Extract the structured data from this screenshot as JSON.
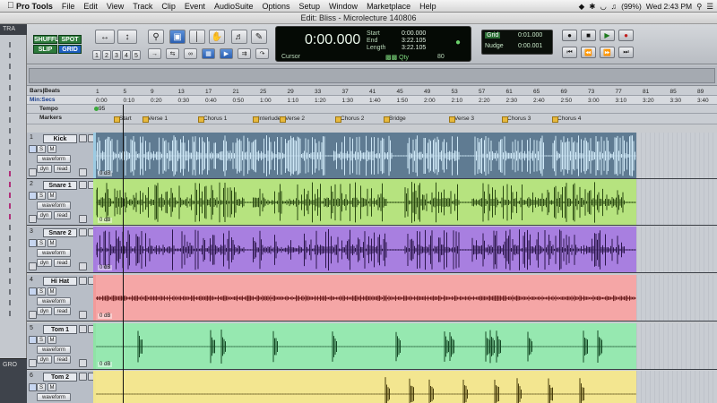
{
  "menubar": {
    "apple": "",
    "items": [
      "Pro Tools",
      "File",
      "Edit",
      "View",
      "Track",
      "Clip",
      "Event",
      "AudioSuite",
      "Options",
      "Setup",
      "Window",
      "Marketplace",
      "Help"
    ],
    "battery": "(99%)",
    "clock": "Wed 2:43 PM"
  },
  "window": {
    "title": "Edit: Bliss - Microlecture 140806"
  },
  "toolbar": {
    "modes": [
      "SHUFFLE",
      "SPOT",
      "SLIP",
      "GRID"
    ],
    "zoom_presets": [
      "1",
      "2",
      "3",
      "4",
      "5"
    ],
    "counter_main": "0:00.000",
    "start_label": "Start",
    "end_label": "End",
    "length_label": "Length",
    "start_value": "0:00.000",
    "end_value": "3:22.105",
    "length_value": "3:22.105",
    "cursor_label": "Cursor",
    "nudge_preset": "80",
    "grid_label": "Grid",
    "grid_value": "0:01.000",
    "nudge_label": "Nudge",
    "nudge_value": "0:00.001"
  },
  "left_panel": {
    "header": "TRA",
    "bottom": "GRO"
  },
  "rulers": {
    "bars_label": "Bars|Beats",
    "mins_label": "Min:Secs",
    "tempo_label": "Tempo",
    "tempo_value": "95",
    "markers_label": "Markers",
    "bars": [
      "1",
      "5",
      "9",
      "13",
      "17",
      "21",
      "25",
      "29",
      "33",
      "37",
      "41",
      "45",
      "49",
      "53",
      "57",
      "61",
      "65",
      "69",
      "73",
      "77",
      "81",
      "85",
      "89"
    ],
    "mins": [
      "0:00",
      "0:10",
      "0:20",
      "0:30",
      "0:40",
      "0:50",
      "1:00",
      "1:10",
      "1:20",
      "1:30",
      "1:40",
      "1:50",
      "2:00",
      "2:10",
      "2:20",
      "2:30",
      "2:40",
      "2:50",
      "3:00",
      "3:10",
      "3:20",
      "3:30",
      "3:40"
    ],
    "markers": [
      "Start",
      "Verse 1",
      "Chorus 1",
      "Interlude",
      "Verse 2",
      "Chorus 2",
      "Bridge",
      "Verse 3",
      "Chorus 3",
      "Chorus 4"
    ]
  },
  "tracks": [
    {
      "num": "1",
      "name": "Kick",
      "view": "waveform",
      "auto": "read",
      "dyn": "dyn",
      "vol": "0 dB",
      "color": "#9ccbe3",
      "bg": "#5f7b92",
      "wave": "#cfe8f7"
    },
    {
      "num": "2",
      "name": "Snare 1",
      "view": "waveform",
      "auto": "read",
      "dyn": "dyn",
      "vol": "0 dB",
      "color": "#b5e882",
      "bg": "#b6e37f",
      "wave": "#2b4a12"
    },
    {
      "num": "3",
      "name": "Snare 2",
      "view": "waveform",
      "auto": "read",
      "dyn": "dyn",
      "vol": "0 dB",
      "color": "#a67be0",
      "bg": "#a87fe0",
      "wave": "#2c174c"
    },
    {
      "num": "4",
      "name": "Hi Hat",
      "view": "waveform",
      "auto": "read",
      "dyn": "dyn",
      "vol": "0 dB",
      "color": "#f29a9a",
      "bg": "#f5a6a6",
      "wave": "#6b1e1e"
    },
    {
      "num": "5",
      "name": "Tom 1",
      "view": "waveform",
      "auto": "read",
      "dyn": "dyn",
      "vol": "0 dB",
      "color": "#8fe3a6",
      "bg": "#96e8b0",
      "wave": "#154a26"
    },
    {
      "num": "6",
      "name": "Tom 2",
      "view": "waveform",
      "auto": "read",
      "dyn": "dyn",
      "vol": "0 dB",
      "color": "#f1e58c",
      "bg": "#f3e690",
      "wave": "#4a3f0d"
    }
  ],
  "colors": {
    "selection": "#3d6fc7",
    "tempo_dot": "#3aa83a"
  }
}
